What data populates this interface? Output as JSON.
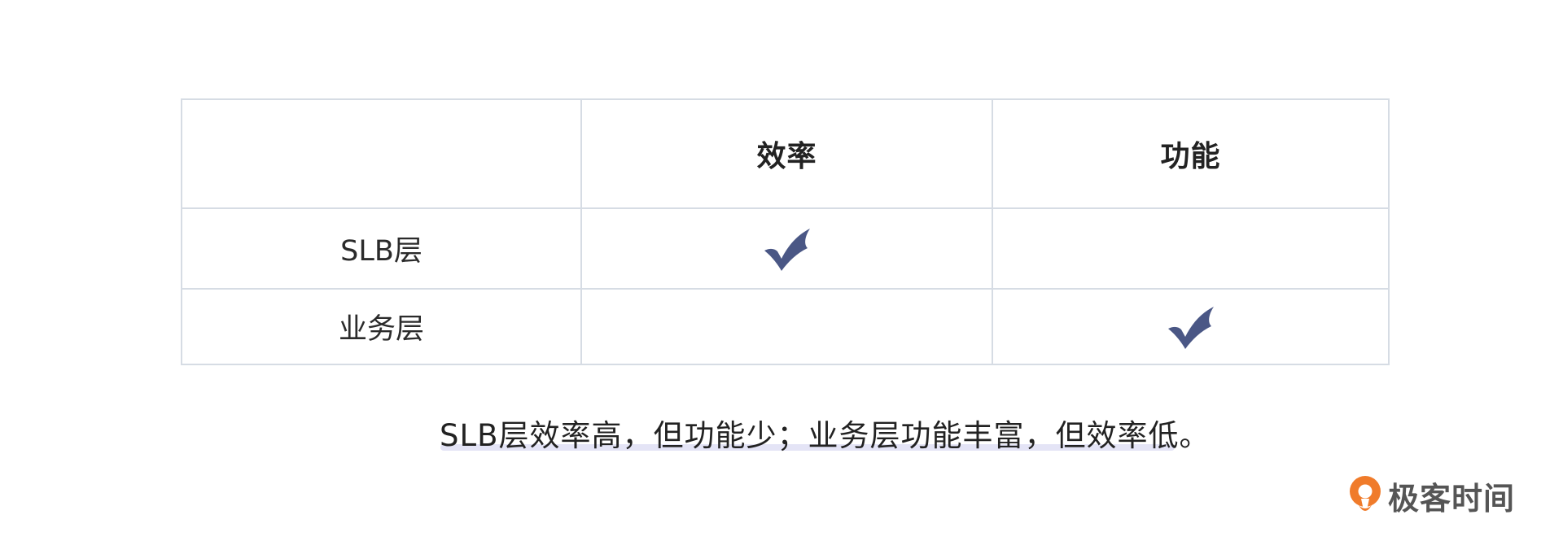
{
  "table": {
    "headers": [
      "",
      "效率",
      "功能"
    ],
    "rows": [
      {
        "label": "SLB层",
        "efficiency_checked": true,
        "function_checked": false
      },
      {
        "label": "业务层",
        "efficiency_checked": false,
        "function_checked": true
      }
    ],
    "check_icon": "checkmark-icon",
    "check_color": "#4a5785"
  },
  "caption": {
    "text": "SLB层效率高，但功能少；业务层功能丰富，但效率低。"
  },
  "brand": {
    "name": "极客时间",
    "logo_icon": "geektime-logo-icon",
    "logo_color": "#f07b2a"
  }
}
